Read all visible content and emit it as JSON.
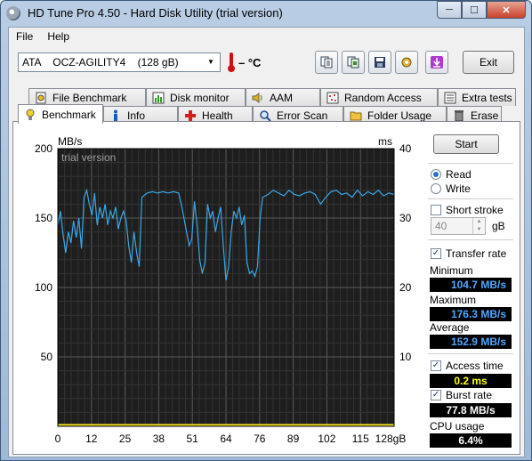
{
  "window": {
    "title": "HD Tune Pro 4.50 - Hard Disk Utility (trial version)",
    "caption_buttons": [
      "minimize",
      "maximize",
      "close"
    ]
  },
  "menu": {
    "file": "File",
    "help": "Help"
  },
  "toolbar": {
    "drive": "ATA    OCZ-AGILITY4    (128 gB)",
    "temperature": "– °C",
    "exit_label": "Exit",
    "icons": [
      "copy-text-icon",
      "copy-screenshot-icon",
      "save-icon",
      "options-icon",
      "download-icon"
    ]
  },
  "tabs": {
    "row1": [
      "File Benchmark",
      "Disk monitor",
      "AAM",
      "Random Access",
      "Extra tests"
    ],
    "row2": [
      "Benchmark",
      "Info",
      "Health",
      "Error Scan",
      "Folder Usage",
      "Erase"
    ],
    "active": "Benchmark"
  },
  "controls": {
    "start_label": "Start",
    "read_label": "Read",
    "write_label": "Write",
    "mode_selected": "Read",
    "short_stroke_label": "Short stroke",
    "short_stroke_checked": false,
    "short_stroke_value": "40",
    "short_stroke_unit": "gB",
    "transfer_rate_label": "Transfer rate",
    "transfer_rate_checked": true,
    "access_time_label": "Access time",
    "access_time_checked": true,
    "burst_rate_label": "Burst rate",
    "burst_rate_checked": true
  },
  "results": {
    "minimum_label": "Minimum",
    "minimum": "104.7 MB/s",
    "maximum_label": "Maximum",
    "maximum": "176.3 MB/s",
    "average_label": "Average",
    "average": "152.9 MB/s",
    "access_time": "0.2 ms",
    "burst_rate": "77.8 MB/s",
    "cpu_usage_label": "CPU usage",
    "cpu_usage": "6.4%"
  },
  "chart_data": {
    "type": "line",
    "watermark": "trial version",
    "ylabel_left": "MB/s",
    "ylabel_right": "ms",
    "ylim_left": [
      0,
      200
    ],
    "ylim_right": [
      0,
      40
    ],
    "yticks_left": [
      "200",
      "150",
      "100",
      "50"
    ],
    "yticks_right": [
      "40",
      "30",
      "20",
      "10"
    ],
    "xlim": [
      0,
      128
    ],
    "xtick_labels": [
      "0",
      "12",
      "25",
      "38",
      "51",
      "64",
      "76",
      "89",
      "102",
      "115",
      "128gB"
    ],
    "grid": true,
    "background": "#1e1e1e",
    "series": [
      {
        "color": "#3aa8e8",
        "x": [
          0,
          1,
          2,
          3,
          4,
          5,
          6,
          7,
          8,
          9,
          10,
          11,
          12,
          13,
          14,
          15,
          16,
          17,
          18,
          19,
          20,
          21,
          22,
          23,
          24,
          25,
          26,
          27,
          28,
          29,
          30,
          31,
          32,
          34,
          36,
          38,
          40,
          42,
          44,
          46,
          47,
          48,
          49,
          50,
          51,
          52,
          53,
          54,
          55,
          56,
          57,
          58,
          59,
          60,
          61,
          62,
          63,
          64,
          65,
          66,
          67,
          68,
          69,
          70,
          71,
          72,
          73,
          74,
          75,
          76,
          77,
          78,
          80,
          82,
          84,
          86,
          88,
          90,
          92,
          94,
          96,
          98,
          100,
          102,
          104,
          106,
          108,
          110,
          112,
          114,
          116,
          118,
          120,
          122,
          124,
          126,
          128
        ],
        "y": [
          145,
          155,
          138,
          125,
          140,
          132,
          148,
          136,
          150,
          128,
          165,
          170,
          160,
          152,
          168,
          145,
          158,
          150,
          160,
          145,
          155,
          150,
          158,
          142,
          150,
          155,
          148,
          130,
          118,
          140,
          125,
          115,
          165,
          168,
          169,
          168,
          169,
          168,
          169,
          168,
          160,
          150,
          140,
          130,
          135,
          162,
          145,
          120,
          110,
          118,
          160,
          150,
          155,
          140,
          150,
          158,
          130,
          105,
          115,
          140,
          155,
          150,
          158,
          145,
          152,
          118,
          110,
          112,
          108,
          115,
          150,
          165,
          167,
          170,
          168,
          166,
          170,
          167,
          166,
          168,
          169,
          167,
          160,
          165,
          169,
          170,
          167,
          168,
          165,
          170,
          166,
          169,
          167,
          170,
          166,
          168,
          167
        ]
      },
      {
        "color": "#f0e020",
        "x": [
          0,
          128
        ],
        "y": [
          0.2,
          0.2
        ]
      }
    ]
  }
}
